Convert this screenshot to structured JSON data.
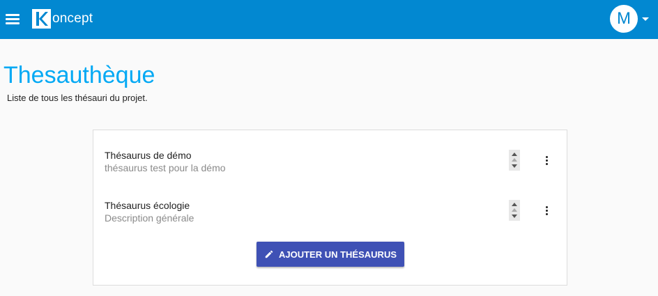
{
  "header": {
    "app_name": "oncept",
    "logo_letter": "K",
    "avatar_letter": "M",
    "colors": {
      "bar": "#0288d1",
      "text": "#ffffff"
    }
  },
  "page": {
    "title": "Thesauthèque",
    "subtitle": "Liste de tous les thésauri du projet."
  },
  "thesauri": [
    {
      "title": "Thésaurus de démo",
      "description": "thésaurus test pour la démo"
    },
    {
      "title": "Thésaurus écologie",
      "description": "Description générale"
    }
  ],
  "actions": {
    "add_label": "AJOUTER UN THÉSAURUS",
    "add_icon": "pencil-icon"
  },
  "colors": {
    "title": "#03a9f4",
    "button": "#3f51b5"
  }
}
